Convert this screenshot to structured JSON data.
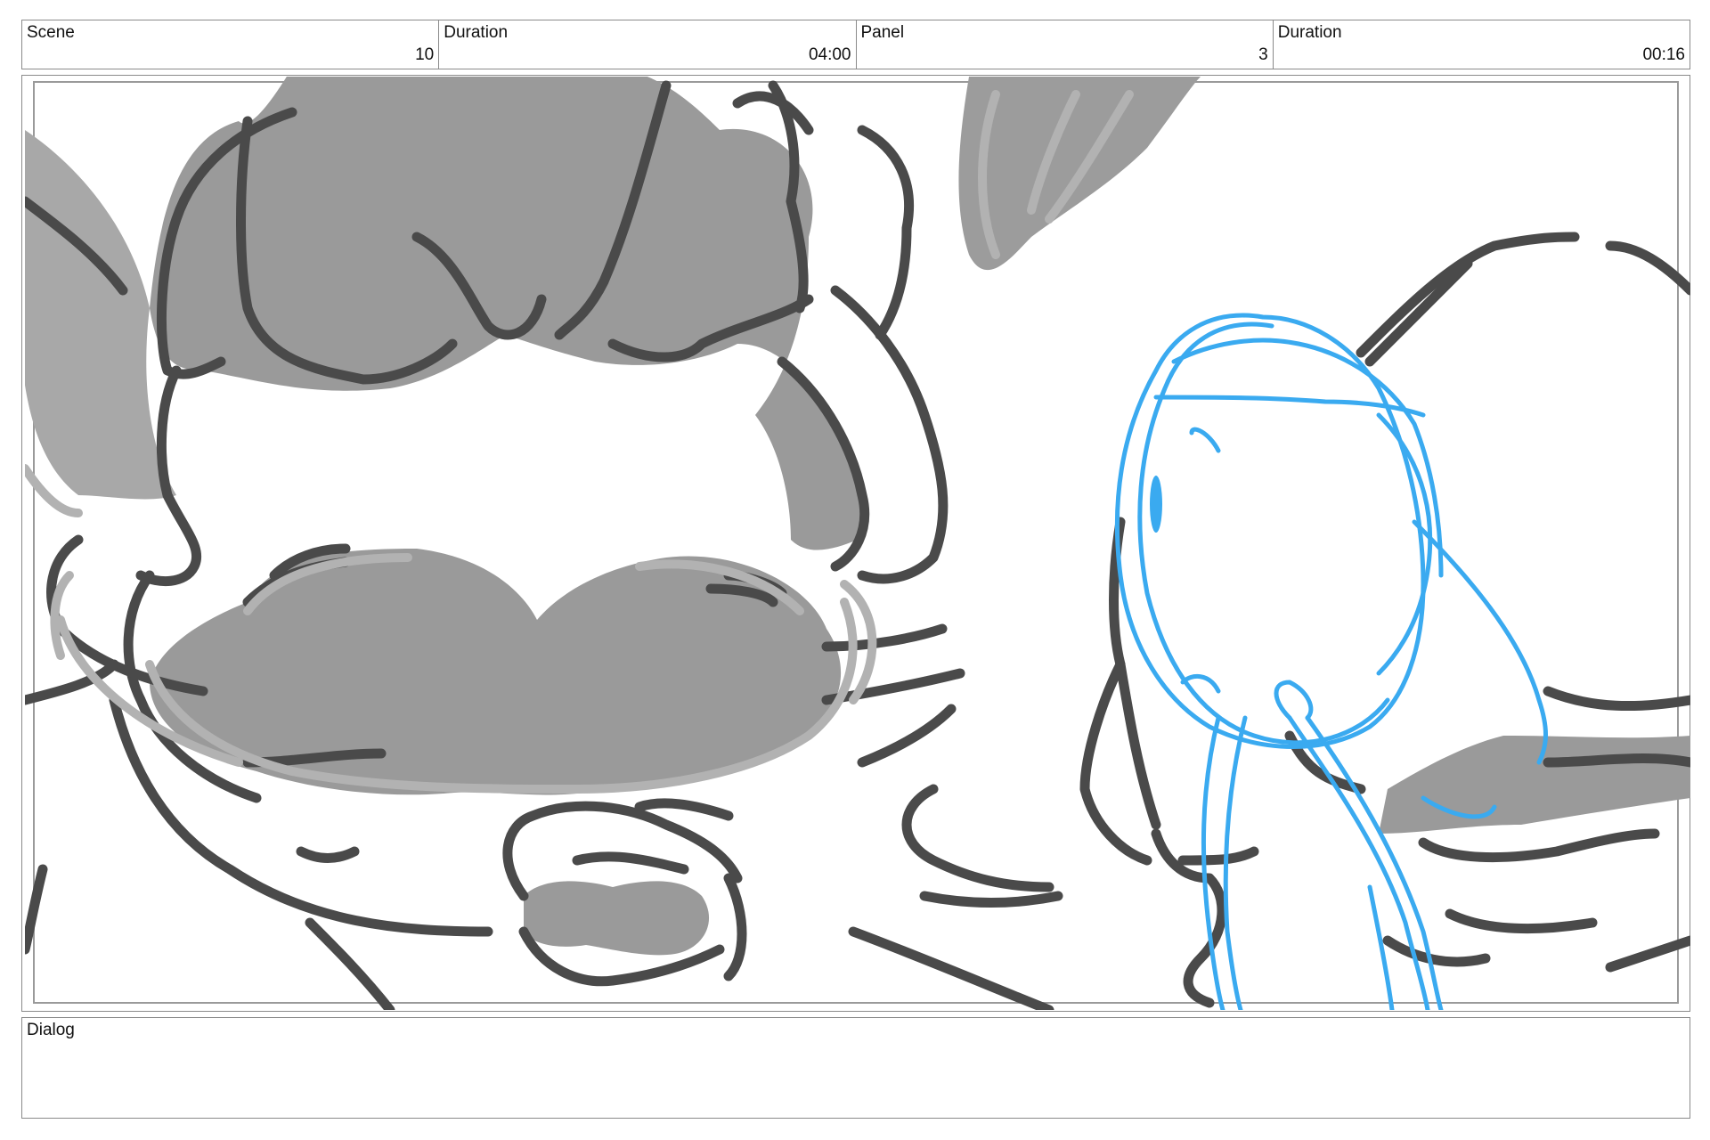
{
  "header": {
    "scene_label": "Scene",
    "scene_value": "10",
    "scene_duration_label": "Duration",
    "scene_duration_value": "04:00",
    "panel_label": "Panel",
    "panel_value": "3",
    "panel_duration_label": "Duration",
    "panel_duration_value": "00:16"
  },
  "dialog": {
    "label": "Dialog",
    "text": ""
  },
  "colors": {
    "line": "#4a4a4a",
    "fill": "#9a9a9a",
    "light_fill": "#b8b8b8",
    "sketch_blue": "#3aaaf0"
  }
}
